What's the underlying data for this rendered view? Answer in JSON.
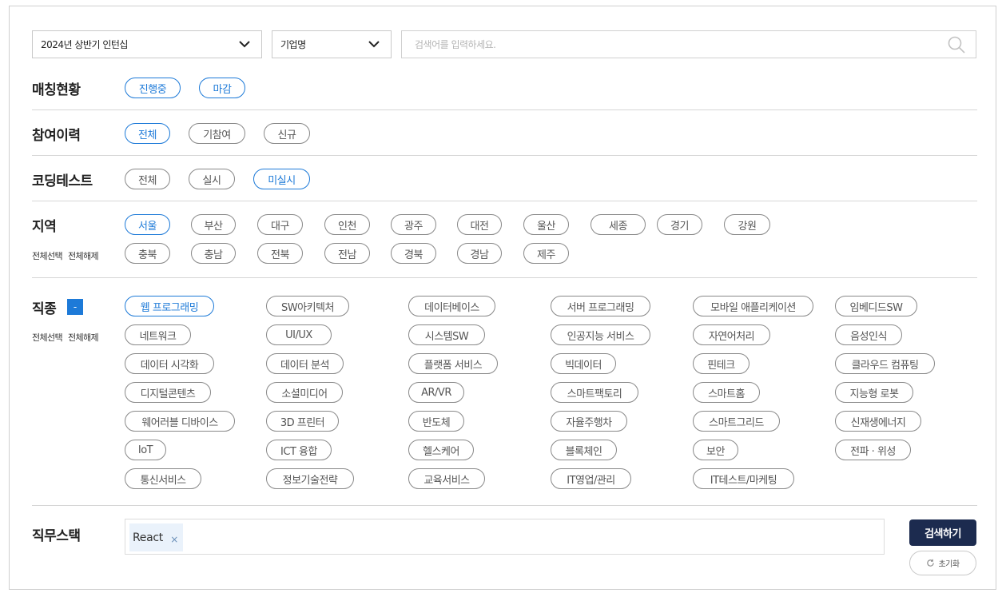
{
  "filters": {
    "period": "2024년 상반기 인턴십",
    "search_type": "기업명",
    "search_placeholder": "검색어를 입력하세요."
  },
  "sections": {
    "matching": {
      "label": "매칭현황",
      "chips": [
        "진행중",
        "마감"
      ]
    },
    "participation": {
      "label": "참여이력",
      "chips": [
        "전체",
        "기참여",
        "신규"
      ]
    },
    "coding": {
      "label": "코딩테스트",
      "chips": [
        "전체",
        "실시",
        "미실시"
      ]
    },
    "region": {
      "label": "지역",
      "select_all": "전체선택",
      "deselect_all": "전체해제",
      "chips": [
        "서울",
        "부산",
        "대구",
        "인천",
        "광주",
        "대전",
        "울산",
        "세종",
        "경기",
        "강원",
        "충북",
        "충남",
        "전북",
        "전남",
        "경북",
        "경남",
        "제주"
      ]
    },
    "job": {
      "label": "직종",
      "toggle": "-",
      "select_all": "전체선택",
      "deselect_all": "전체해제",
      "chips": [
        "웹 프로그래밍",
        "SW아키텍처",
        "데이터베이스",
        "서버 프로그래밍",
        "모바일 애플리케이션",
        "임베디드SW",
        "네트워크",
        "UI/UX",
        "시스템SW",
        "인공지능 서비스",
        "자연어처리",
        "음성인식",
        "데이터 시각화",
        "데이터 분석",
        "플랫폼 서비스",
        "빅데이터",
        "핀테크",
        "클라우드 컴퓨팅",
        "디지털콘텐츠",
        "소셜미디어",
        "AR/VR",
        "스마트팩토리",
        "스마트홈",
        "지능형 로봇",
        "웨어러블 디바이스",
        "3D 프린터",
        "반도체",
        "자율주행차",
        "스마트그리드",
        "신재생에너지",
        "IoT",
        "ICT 융합",
        "헬스케어",
        "블록체인",
        "보안",
        "전파 · 위성",
        "통신서비스",
        "정보기술전략",
        "교육서비스",
        "IT영업/관리",
        "IT테스트/마케팅"
      ]
    },
    "stack": {
      "label": "직무스택",
      "tags": [
        "React"
      ],
      "remove_icon": "×"
    }
  },
  "actions": {
    "search": "검색하기",
    "reset": "초기화"
  },
  "colors": {
    "accent": "#1d7ad8",
    "primary_button": "#1c2b4f"
  }
}
